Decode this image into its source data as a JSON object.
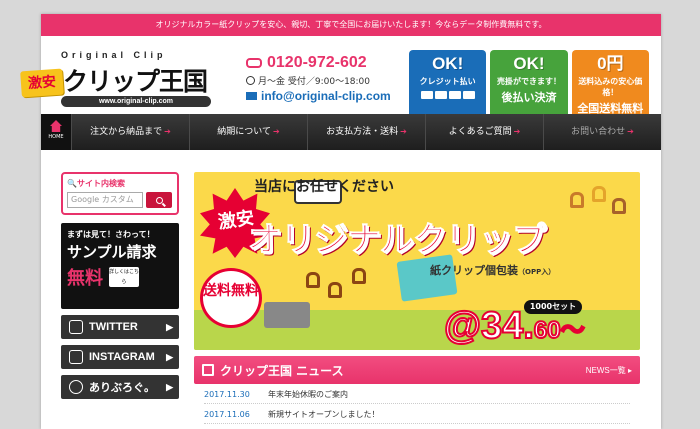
{
  "topbar": {
    "text": "オリジナルカラー紙クリップを安心、親切、丁寧で全国にお届けいたします！今ならデータ制作費無料です。"
  },
  "logo": {
    "tagline": "Original Clip",
    "badge": "激安",
    "name": "クリップ王国",
    "url": "www.original-clip.com"
  },
  "contact": {
    "phone": "0120-972-602",
    "hours": "月〜金 受付／9:00〜18:00",
    "email": "info@original-clip.com"
  },
  "badges": [
    {
      "ok": "OK!",
      "title": "クレジット払い",
      "sub": "",
      "color": "#1a6db8"
    },
    {
      "ok": "OK!",
      "title": "売掛ができます！",
      "sub": "後払い決済",
      "color": "#47a33c"
    },
    {
      "ok": "0円",
      "title": "送料込みの安心価格！",
      "sub": "全国送料無料",
      "color": "#f08a1e"
    }
  ],
  "nav": {
    "home": "HOME",
    "items": [
      "注文から納品まで",
      "納期について",
      "お支払方法・送料",
      "よくあるご質問",
      "お問い合わせ"
    ]
  },
  "sidebar": {
    "search_title": "サイト内検索",
    "search_placeholder": "Google カスタム",
    "sample": {
      "l1": "まずは見て！さわって！",
      "l2": "サンプル請求",
      "free": "無料",
      "more": "詳しくはこちら"
    },
    "social": [
      "TWITTER",
      "INSTAGRAM",
      "ありぶろぐ。"
    ]
  },
  "hero": {
    "top": "当店にお任せください",
    "burst": "激安",
    "main": "オリジナルクリップ",
    "free": "送料無料",
    "pack": "紙クリップ個包装",
    "pack_note": "（OPP入）",
    "set": "1000セット",
    "price_main": "@34.",
    "price_sub": "60〜"
  },
  "news": {
    "title": "クリップ王国 ニュース",
    "more": "NEWS一覧 ▸",
    "items": [
      {
        "date": "2017.11.30",
        "text": "年末年始休暇のご案内"
      },
      {
        "date": "2017.11.06",
        "text": "新規サイトオープンしました！"
      }
    ]
  }
}
